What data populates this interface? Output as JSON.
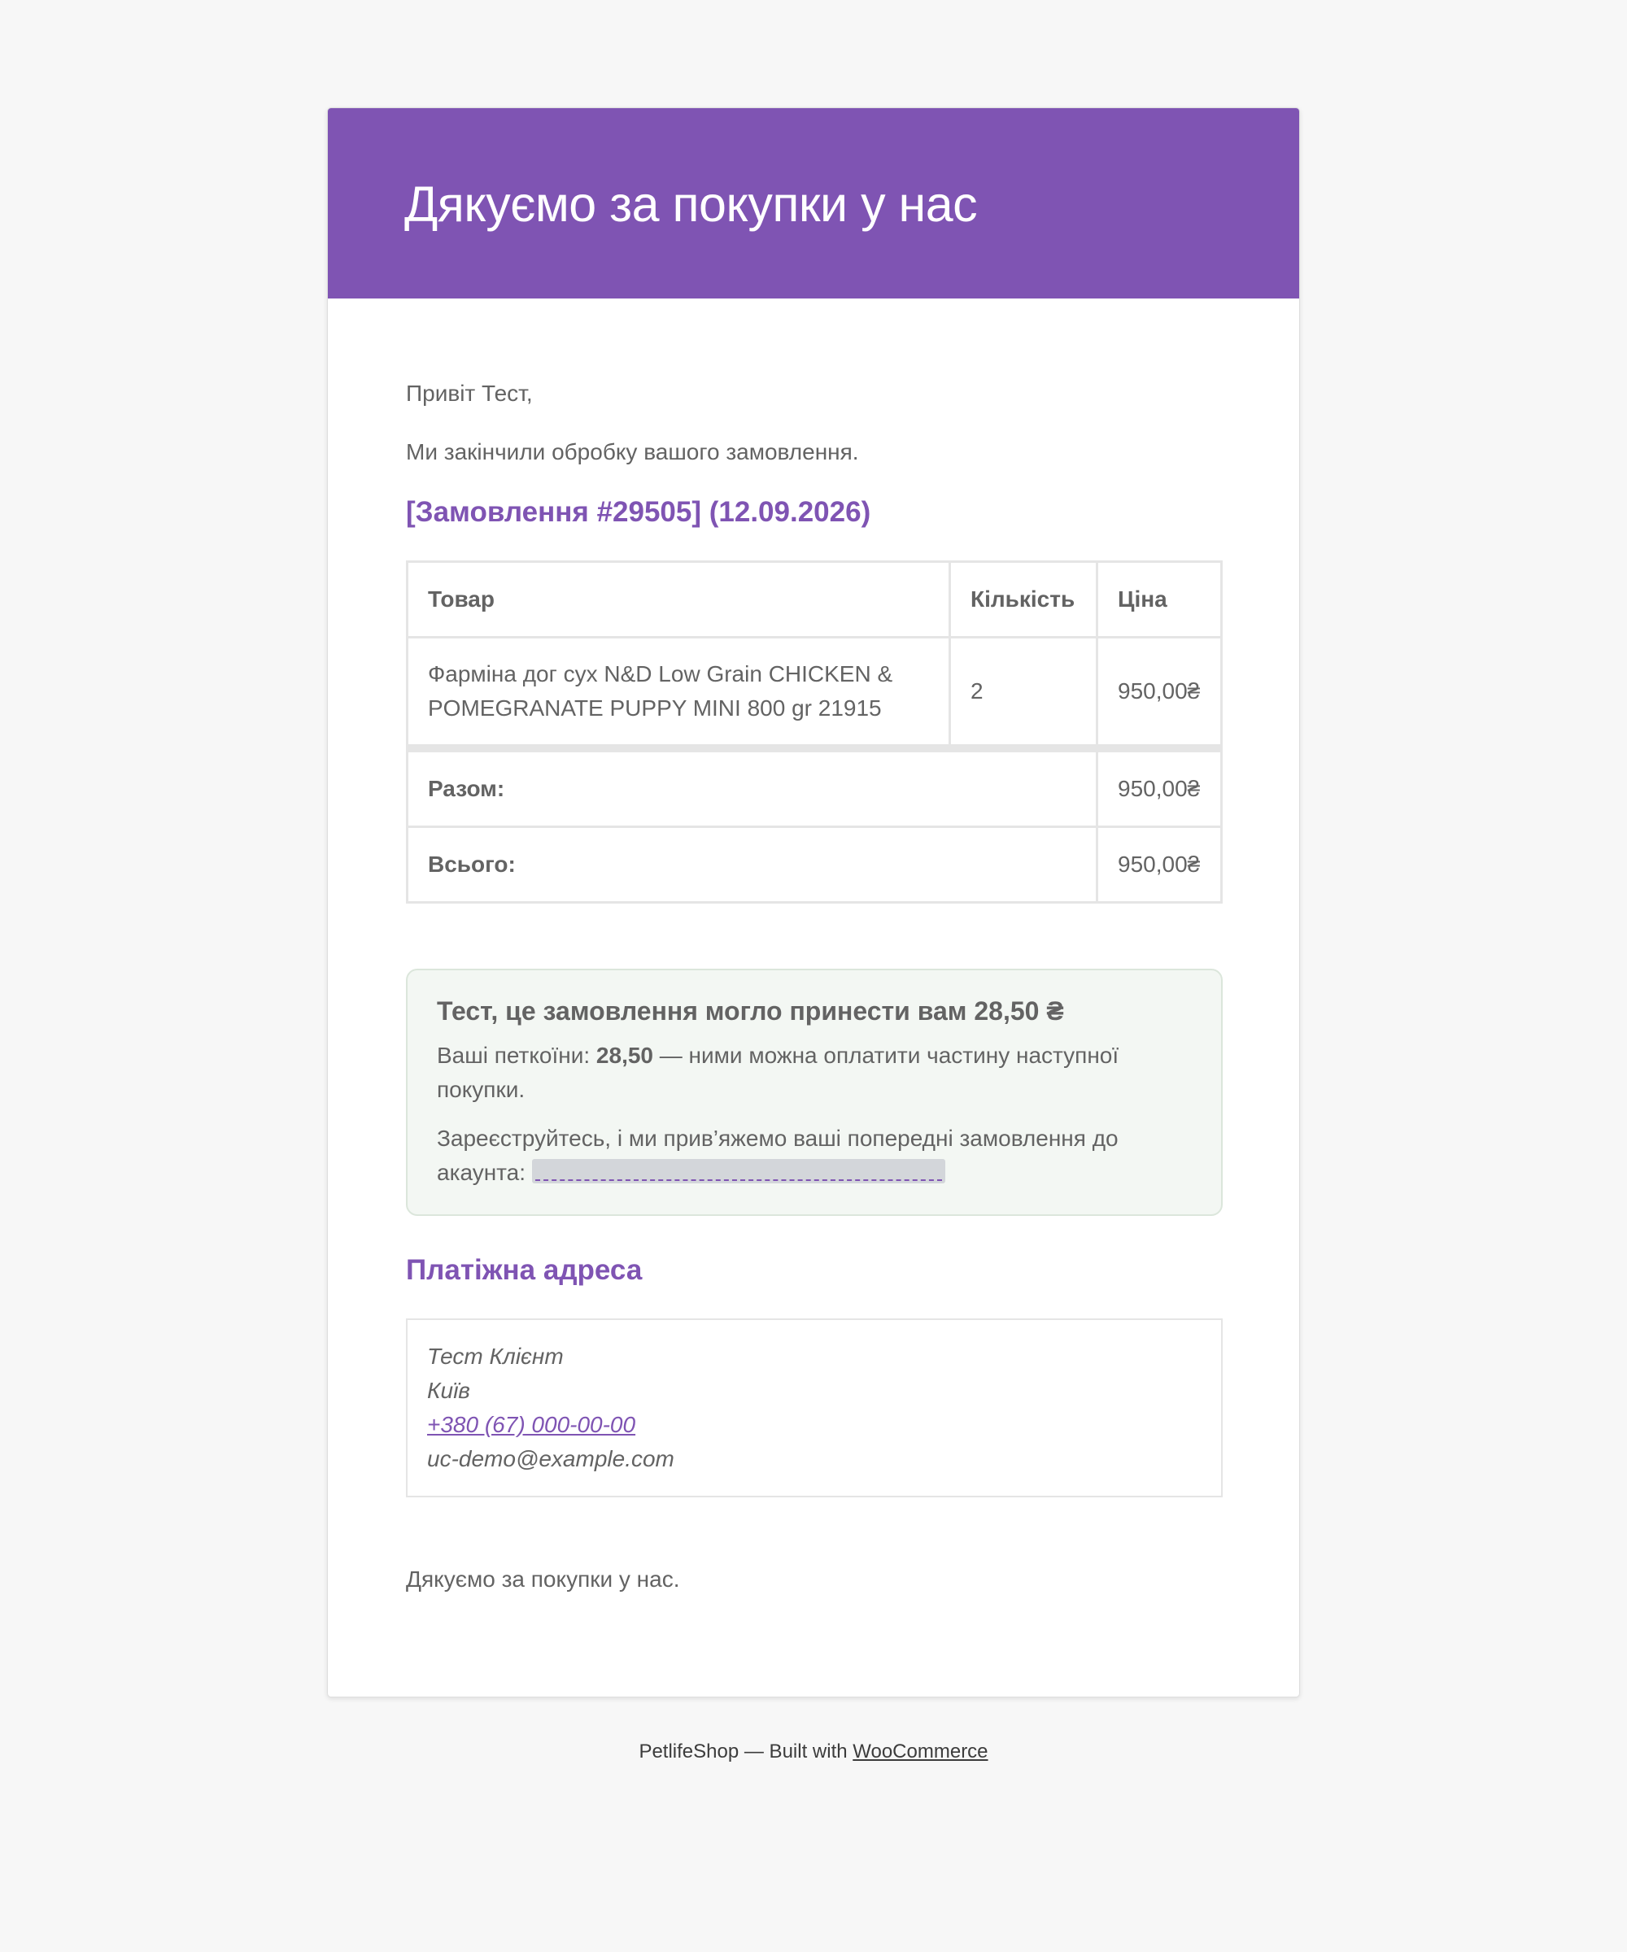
{
  "header": {
    "title": "Дякуємо за покупки у нас"
  },
  "body": {
    "greeting": "Привіт Тест,",
    "intro": "Ми закінчили обробку вашого замовлення.",
    "order_heading": "[Замовлення #29505] (12.09.2026)"
  },
  "order_table": {
    "headers": {
      "product": "Товар",
      "quantity": "Кількість",
      "price": "Ціна"
    },
    "items": [
      {
        "product": "Фарміна дог сух N&D Low Grain CHICKEN & POMEGRANATE PUPPY MINI 800 gr 21915",
        "quantity": "2",
        "price": "950,00₴"
      }
    ],
    "totals": [
      {
        "label": "Разом:",
        "value": "950,00₴"
      },
      {
        "label": "Всього:",
        "value": "950,00₴"
      }
    ]
  },
  "promo": {
    "title": "Тест, це замовлення могло принести вам 28,50 ₴",
    "points_prefix": "Ваші петкоїни:",
    "points_value": "28,50",
    "points_suffix": "— ними можна оплатити частину наступної покупки.",
    "register_text": "Зареєструйтесь, і ми прив’яжемо ваші попередні замовлення до акаунта:"
  },
  "billing": {
    "heading": "Платіжна адреса",
    "name": "Тест Клієнт",
    "city": "Київ",
    "phone": "+380 (67) 000-00-00",
    "email": "uc-demo@example.com"
  },
  "closing": "Дякуємо за покупки у нас.",
  "footer": {
    "shop_name": "PetlifeShop",
    "built_with": "— Built with",
    "link_text": "WooCommerce"
  },
  "colors": {
    "accent": "#7f54b3",
    "background": "#f7f7f7",
    "text": "#636363",
    "promo_bg": "#f3f7f3",
    "border": "#e5e5e5"
  }
}
